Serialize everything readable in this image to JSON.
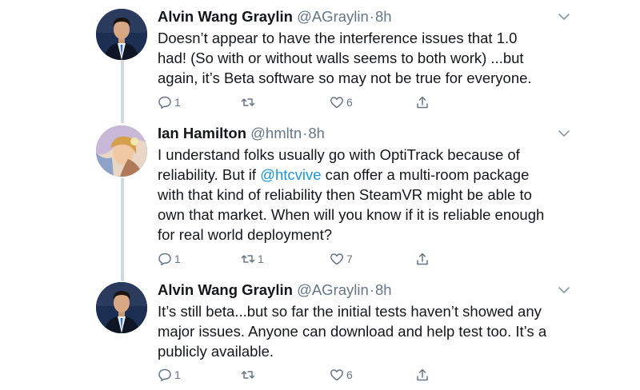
{
  "colors": {
    "text": "#14171a",
    "secondary": "#657786",
    "link": "#1b95e0",
    "thread_line": "#cfd9de"
  },
  "tweets": [
    {
      "author_name": "Alvin Wang Graylin",
      "author_handle": "@AGraylin",
      "separator": "·",
      "time": "8h",
      "text": "Doesn’t appear to have the interference issues that 1.0\nhad! (So with or without walls seems to both work) ...but\nagain, it’s Beta software so may not be true for everyone.",
      "reply_count": "1",
      "retweet_count": "",
      "like_count": "6",
      "avatar_icon": "man-in-suit-avatar"
    },
    {
      "author_name": "Ian Hamilton",
      "author_handle": "@hmltn",
      "separator": "·",
      "time": "8h",
      "text_before": "I understand folks usually go with OptiTrack because of\nreliability. But if ",
      "mention": "@htcvive",
      "text_after": " can offer a multi-room package\nwith that kind of reliability then SteamVR might be able to\nown that market. When will you know if it is reliable enough\nfor real world deployment?",
      "reply_count": "1",
      "retweet_count": "1",
      "like_count": "7",
      "avatar_icon": "painted-portrait-avatar"
    },
    {
      "author_name": "Alvin Wang Graylin",
      "author_handle": "@AGraylin",
      "separator": "·",
      "time": "8h",
      "text": "It’s still beta...but so far the initial tests haven’t showed any\nmajor issues. Anyone can download and help test too. It’s a\npublicly available.",
      "reply_count": "1",
      "retweet_count": "",
      "like_count": "6",
      "avatar_icon": "man-in-suit-avatar"
    }
  ]
}
